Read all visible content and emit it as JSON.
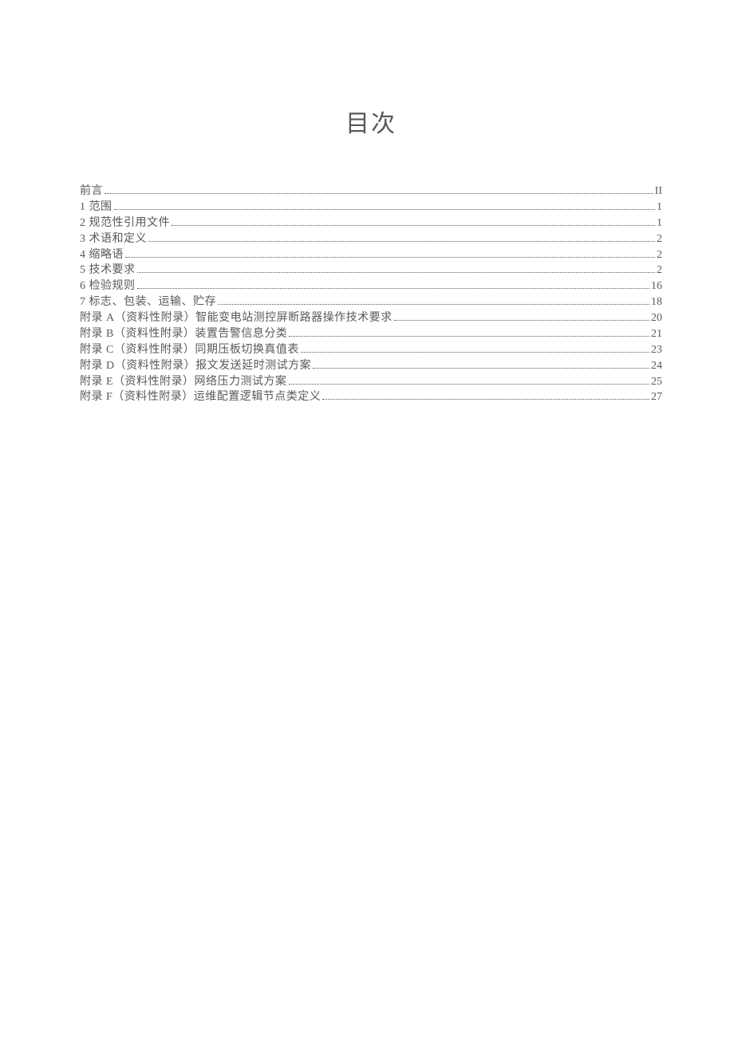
{
  "title": "目次",
  "toc": [
    {
      "label": "前言",
      "page": "II"
    },
    {
      "label": "1 范围",
      "page": "1"
    },
    {
      "label": "2 规范性引用文件",
      "page": "1"
    },
    {
      "label": "3 术语和定义",
      "page": "2"
    },
    {
      "label": "4 缩略语",
      "page": "2"
    },
    {
      "label": "5 技术要求",
      "page": "2"
    },
    {
      "label": "6 检验规则",
      "page": "16"
    },
    {
      "label": "7 标志、包装、运输、贮存",
      "page": "18"
    },
    {
      "label": "附录 A（资料性附录）智能变电站测控屏断路器操作技术要求",
      "page": "20"
    },
    {
      "label": "附录 B（资料性附录）装置告警信息分类",
      "page": "21"
    },
    {
      "label": "附录 C（资料性附录）同期压板切换真值表",
      "page": "23"
    },
    {
      "label": "附录 D（资料性附录）报文发送延时测试方案",
      "page": "24"
    },
    {
      "label": "附录 E（资料性附录）网络压力测试方案",
      "page": "25"
    },
    {
      "label": "附录 F（资料性附录）运维配置逻辑节点类定义",
      "page": "27"
    }
  ]
}
